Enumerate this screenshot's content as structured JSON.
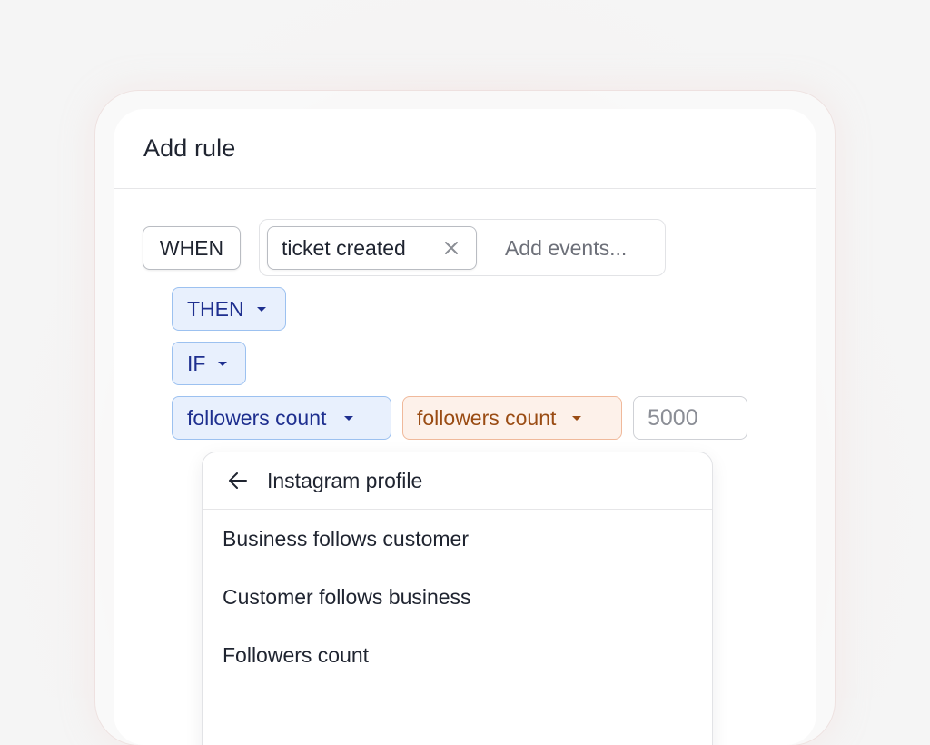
{
  "dialog": {
    "title": "Add rule"
  },
  "rule": {
    "when_label": "WHEN",
    "event_chip": "ticket created",
    "events_placeholder": "Add events...",
    "then_label": "THEN",
    "if_label": "IF",
    "field_label": "followers count",
    "operator_label": "followers count",
    "value_placeholder": "5000"
  },
  "dropdown": {
    "header": "Instagram profile",
    "items": [
      {
        "label": "Business follows customer"
      },
      {
        "label": "Customer follows business"
      },
      {
        "label": "Followers count"
      }
    ]
  },
  "icons": {
    "chip_remove": "close-icon",
    "caret": "caret-down-icon",
    "back": "arrow-left-icon"
  },
  "colors": {
    "blue_fill": "#e8f0fd",
    "blue_border": "#9cc1f0",
    "blue_text": "#1e2f8f",
    "orange_fill": "#fdf1ea",
    "orange_border": "#f0b99b",
    "orange_text": "#9a4c14"
  }
}
